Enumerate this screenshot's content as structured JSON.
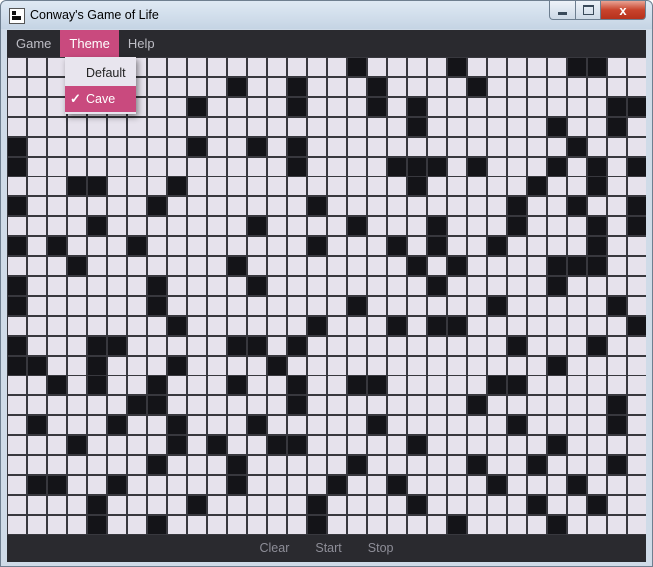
{
  "window": {
    "title": "Conway's Game of Life",
    "close_glyph": "x"
  },
  "menubar": {
    "items": [
      {
        "label": "Game",
        "active": false
      },
      {
        "label": "Theme",
        "active": true
      },
      {
        "label": "Help",
        "active": false
      }
    ]
  },
  "theme_menu": {
    "items": [
      {
        "label": "Default",
        "checked": false
      },
      {
        "label": "Cave",
        "checked": true
      }
    ],
    "check_glyph": "✓"
  },
  "controls": {
    "clear_label": "Clear",
    "start_label": "Start",
    "stop_label": "Stop"
  },
  "board": {
    "columns": 32,
    "rows": 24,
    "dead_color": "#e6e2ec",
    "alive_color": "#141418",
    "alive_cells": [
      [
        0,
        17
      ],
      [
        0,
        22
      ],
      [
        0,
        28
      ],
      [
        0,
        29
      ],
      [
        1,
        11
      ],
      [
        1,
        14
      ],
      [
        1,
        18
      ],
      [
        1,
        23
      ],
      [
        2,
        9
      ],
      [
        2,
        14
      ],
      [
        2,
        18
      ],
      [
        2,
        20
      ],
      [
        2,
        30
      ],
      [
        2,
        31
      ],
      [
        3,
        20
      ],
      [
        3,
        27
      ],
      [
        3,
        30
      ],
      [
        4,
        0
      ],
      [
        4,
        9
      ],
      [
        4,
        12
      ],
      [
        4,
        14
      ],
      [
        4,
        28
      ],
      [
        5,
        0
      ],
      [
        5,
        14
      ],
      [
        5,
        19
      ],
      [
        5,
        20
      ],
      [
        5,
        21
      ],
      [
        5,
        23
      ],
      [
        5,
        27
      ],
      [
        5,
        29
      ],
      [
        5,
        31
      ],
      [
        6,
        3
      ],
      [
        6,
        4
      ],
      [
        6,
        8
      ],
      [
        6,
        20
      ],
      [
        6,
        26
      ],
      [
        6,
        29
      ],
      [
        7,
        0
      ],
      [
        7,
        7
      ],
      [
        7,
        15
      ],
      [
        7,
        25
      ],
      [
        7,
        28
      ],
      [
        7,
        31
      ],
      [
        8,
        4
      ],
      [
        8,
        12
      ],
      [
        8,
        17
      ],
      [
        8,
        21
      ],
      [
        8,
        25
      ],
      [
        8,
        29
      ],
      [
        8,
        31
      ],
      [
        9,
        0
      ],
      [
        9,
        2
      ],
      [
        9,
        6
      ],
      [
        9,
        15
      ],
      [
        9,
        19
      ],
      [
        9,
        21
      ],
      [
        9,
        24
      ],
      [
        9,
        29
      ],
      [
        10,
        3
      ],
      [
        10,
        11
      ],
      [
        10,
        20
      ],
      [
        10,
        22
      ],
      [
        10,
        27
      ],
      [
        10,
        28
      ],
      [
        10,
        29
      ],
      [
        11,
        0
      ],
      [
        11,
        7
      ],
      [
        11,
        12
      ],
      [
        11,
        21
      ],
      [
        11,
        27
      ],
      [
        12,
        0
      ],
      [
        12,
        7
      ],
      [
        12,
        17
      ],
      [
        12,
        24
      ],
      [
        12,
        30
      ],
      [
        13,
        8
      ],
      [
        13,
        15
      ],
      [
        13,
        19
      ],
      [
        13,
        21
      ],
      [
        13,
        22
      ],
      [
        13,
        31
      ],
      [
        14,
        0
      ],
      [
        14,
        4
      ],
      [
        14,
        5
      ],
      [
        14,
        11
      ],
      [
        14,
        12
      ],
      [
        14,
        14
      ],
      [
        14,
        25
      ],
      [
        14,
        29
      ],
      [
        15,
        0
      ],
      [
        15,
        1
      ],
      [
        15,
        4
      ],
      [
        15,
        8
      ],
      [
        15,
        13
      ],
      [
        15,
        27
      ],
      [
        16,
        2
      ],
      [
        16,
        4
      ],
      [
        16,
        7
      ],
      [
        16,
        11
      ],
      [
        16,
        14
      ],
      [
        16,
        17
      ],
      [
        16,
        18
      ],
      [
        16,
        24
      ],
      [
        16,
        25
      ],
      [
        17,
        6
      ],
      [
        17,
        7
      ],
      [
        17,
        14
      ],
      [
        17,
        23
      ],
      [
        17,
        30
      ],
      [
        18,
        1
      ],
      [
        18,
        5
      ],
      [
        18,
        8
      ],
      [
        18,
        12
      ],
      [
        18,
        18
      ],
      [
        18,
        25
      ],
      [
        18,
        30
      ],
      [
        19,
        3
      ],
      [
        19,
        8
      ],
      [
        19,
        10
      ],
      [
        19,
        13
      ],
      [
        19,
        14
      ],
      [
        19,
        20
      ],
      [
        19,
        27
      ],
      [
        20,
        7
      ],
      [
        20,
        11
      ],
      [
        20,
        17
      ],
      [
        20,
        23
      ],
      [
        20,
        26
      ],
      [
        20,
        30
      ],
      [
        21,
        1
      ],
      [
        21,
        2
      ],
      [
        21,
        5
      ],
      [
        21,
        11
      ],
      [
        21,
        16
      ],
      [
        21,
        19
      ],
      [
        21,
        24
      ],
      [
        21,
        28
      ],
      [
        22,
        4
      ],
      [
        22,
        9
      ],
      [
        22,
        15
      ],
      [
        22,
        20
      ],
      [
        22,
        26
      ],
      [
        22,
        29
      ],
      [
        23,
        4
      ],
      [
        23,
        7
      ],
      [
        23,
        15
      ],
      [
        23,
        22
      ],
      [
        23,
        27
      ]
    ]
  }
}
